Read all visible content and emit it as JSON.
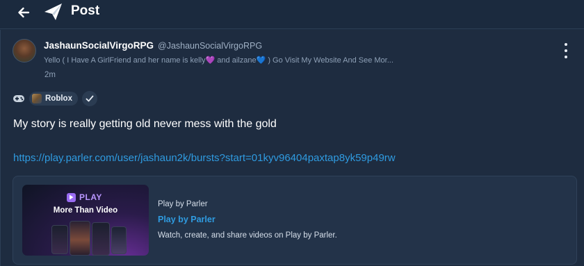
{
  "header": {
    "title": "Post",
    "back_icon": "arrow-left-icon",
    "logo_icon": "parler-logo-icon"
  },
  "post": {
    "author": {
      "display_name": "JashaunSocialVirgoRPG",
      "handle": "@JashaunSocialVirgoRPG",
      "bio_prefix": "Yello ( I Have A GirlFriend and her name is kelly",
      "bio_heart1": "💜",
      "bio_middle": " and ailzane",
      "bio_heart2": "💙",
      "bio_suffix": " ) Go Visit My Website And See Mor..."
    },
    "timestamp": "2m",
    "tag": {
      "label": "Roblox",
      "icon": "gamepad-icon"
    },
    "text": "My story is really getting old never mess with the gold",
    "link": "https://play.parler.com/user/jashaun2k/bursts?start=01kyv96404paxtap8yk59p49rw",
    "link_card": {
      "thumbnail_brand": "PLAY",
      "thumbnail_headline": "More Than Video",
      "site_name": "Play by Parler",
      "title": "Play by Parler",
      "description": "Watch, create, and share videos on Play by Parler."
    }
  },
  "colors": {
    "background": "#1b2a3e",
    "accent_link": "#2f9be0",
    "text_primary": "#ffffff",
    "text_secondary": "#8ea0b6"
  }
}
